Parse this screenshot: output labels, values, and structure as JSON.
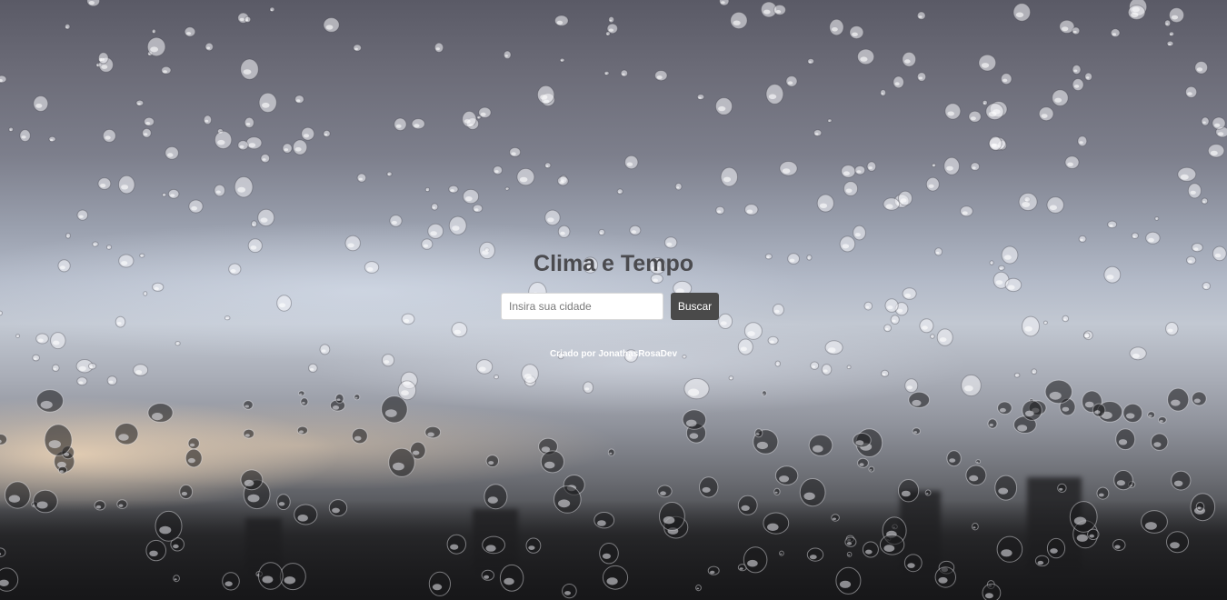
{
  "page": {
    "title": "Clima e Tempo",
    "background": "rainy-window-photo"
  },
  "search": {
    "placeholder": "Insira sua cidade",
    "value": "",
    "button_label": "Buscar"
  },
  "footer": {
    "prefix": "Criado por ",
    "author": "JonathasRosaDev"
  },
  "colors": {
    "title": "#4b4b4f",
    "button_bg": "#4a4a4a",
    "button_text": "#ffffff",
    "credit_text": "#ffffff"
  }
}
